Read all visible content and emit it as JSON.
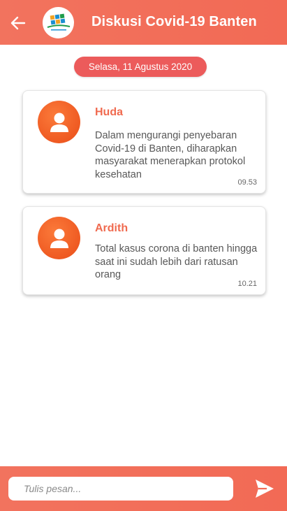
{
  "header": {
    "title": "Diskusi Covid-19 Banten",
    "back_icon": "arrow-left-icon",
    "logo_icon": "organization-logo"
  },
  "date_separator": "Selasa, 11 Agustus 2020",
  "messages": [
    {
      "sender": "Huda",
      "text": "Dalam mengurangi penyebaran Covid-19 di Banten, diharapkan masyarakat menerapkan protokol kesehatan",
      "time": "09.53",
      "avatar_icon": "user-icon"
    },
    {
      "sender": "Ardith",
      "text": "Total kasus corona di banten hingga saat ini sudah lebih dari ratusan orang",
      "time": "10.21",
      "avatar_icon": "user-icon"
    }
  ],
  "composer": {
    "placeholder": "Tulis pesan...",
    "value": "",
    "send_icon": "send-icon"
  },
  "colors": {
    "accent": "#f26a55",
    "date_pill": "#ec5b5b",
    "sender_name": "#f06a4f",
    "avatar": "#ef5a22"
  }
}
